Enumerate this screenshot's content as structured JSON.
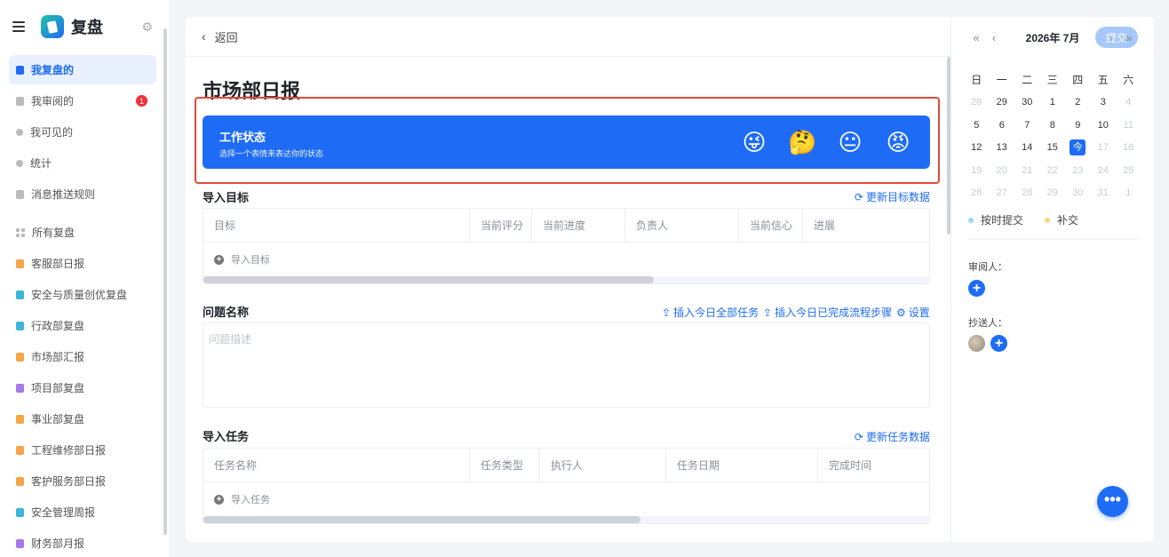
{
  "app": {
    "title": "复盘"
  },
  "sidebar": {
    "items": [
      {
        "label": "我复盘的",
        "active": true
      },
      {
        "label": "我审阅的",
        "badge": "1"
      },
      {
        "label": "我可见的"
      },
      {
        "label": "统计"
      },
      {
        "label": "消息推送规则"
      }
    ],
    "section_label": "所有复盘",
    "boards": [
      {
        "label": "客服部日报",
        "color": "#f5a54a"
      },
      {
        "label": "安全与质量创优复盘",
        "color": "#3cb6d8"
      },
      {
        "label": "行政部复盘",
        "color": "#3cb6d8"
      },
      {
        "label": "市场部汇报",
        "color": "#f5a54a"
      },
      {
        "label": "项目部复盘",
        "color": "#a77ae8"
      },
      {
        "label": "事业部复盘",
        "color": "#f5a54a"
      },
      {
        "label": "工程维修部日报",
        "color": "#f5a54a"
      },
      {
        "label": "客护服务部日报",
        "color": "#f5a54a"
      },
      {
        "label": "安全管理周报",
        "color": "#3cb6d8"
      },
      {
        "label": "财务部月报",
        "color": "#a77ae8"
      }
    ]
  },
  "toolbar": {
    "back_label": "返回",
    "submit_label": "提交"
  },
  "page": {
    "title": "市场部日报"
  },
  "work_status": {
    "title": "工作状态",
    "subtitle": "选择一个表情来表达你的状态",
    "emojis": [
      "😜",
      "🤔",
      "😐",
      "😡"
    ]
  },
  "goals": {
    "title": "导入目标",
    "action": "更新目标数据",
    "columns": [
      "目标",
      "当前评分",
      "当前进度",
      "负责人",
      "当前信心",
      "进展"
    ],
    "add_label": "导入目标"
  },
  "issue": {
    "title": "问题名称",
    "actions": [
      "插入今日全部任务",
      "插入今日已完成流程步骤",
      "设置"
    ],
    "placeholder": "问题描述"
  },
  "tasks": {
    "title": "导入任务",
    "action": "更新任务数据",
    "columns": [
      "任务名称",
      "任务类型",
      "执行人",
      "任务日期",
      "完成时间"
    ],
    "add_label": "导入任务"
  },
  "calendar": {
    "month_label": "2026年 7月",
    "weekdays": [
      "日",
      "一",
      "二",
      "三",
      "四",
      "五",
      "六"
    ],
    "weeks": [
      [
        "28",
        "29",
        "30",
        "1",
        "2",
        "3",
        "4"
      ],
      [
        "5",
        "6",
        "7",
        "8",
        "9",
        "10",
        "11"
      ],
      [
        "12",
        "13",
        "14",
        "15",
        "今",
        "17",
        "18"
      ],
      [
        "19",
        "20",
        "21",
        "22",
        "23",
        "24",
        "25"
      ],
      [
        "26",
        "27",
        "28",
        "29",
        "30",
        "31",
        "1"
      ]
    ],
    "legend": [
      {
        "label": "按时提交",
        "color": "#9fd6f5"
      },
      {
        "label": "补交",
        "color": "#f7d77a"
      }
    ]
  },
  "reviewers": {
    "label": "审阅人："
  },
  "cc": {
    "label": "抄送人："
  },
  "colors": {
    "accent": "#1e6cf5",
    "highlight": "#e04a3a",
    "badge": "#f0303a"
  }
}
